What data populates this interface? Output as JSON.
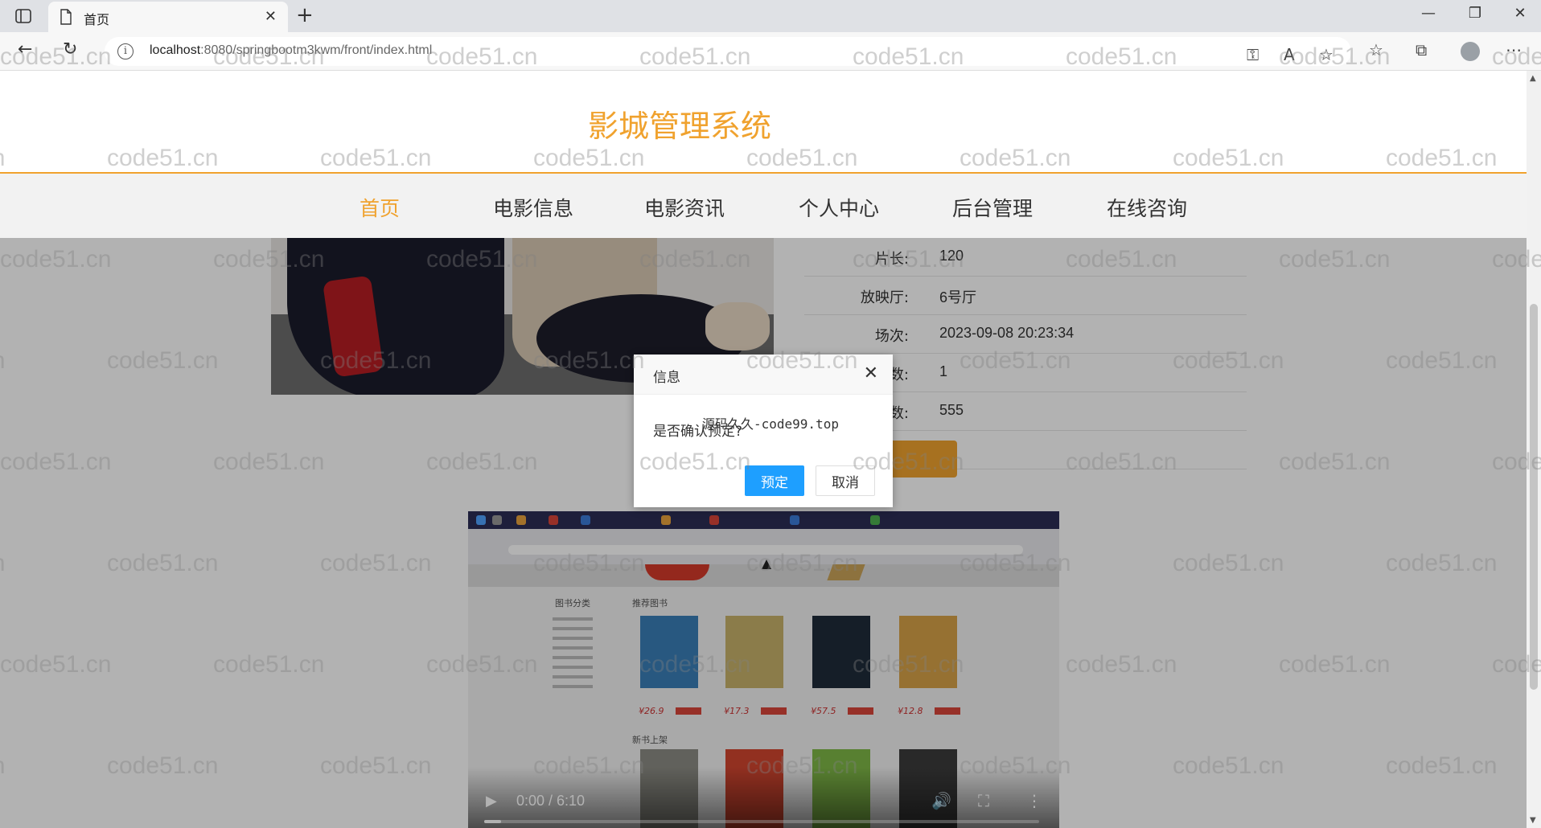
{
  "browser": {
    "tab_title": "首页",
    "url_host": "localhost",
    "url_rest": ":8080/springbootm3kwm/front/index.html"
  },
  "site": {
    "title": "影城管理系统",
    "nav": [
      {
        "label": "首页",
        "active": true
      },
      {
        "label": "电影信息",
        "active": false
      },
      {
        "label": "电影资讯",
        "active": false
      },
      {
        "label": "个人中心",
        "active": false
      },
      {
        "label": "后台管理",
        "active": false
      },
      {
        "label": "在线咨询",
        "active": false
      }
    ]
  },
  "movie": {
    "rows": [
      {
        "label": "片长:",
        "value": "120"
      },
      {
        "label": "放映厅:",
        "value": "6号厅"
      },
      {
        "label": "场次:",
        "value": "2023-09-08 20:23:34"
      },
      {
        "label": "数:",
        "value": "1"
      },
      {
        "label": "数:",
        "value": "555"
      }
    ]
  },
  "video": {
    "time": "0:00 / 6:10",
    "progress": 0.03,
    "inner_headings": [
      "图书分类",
      "推荐图书",
      "新书上架"
    ],
    "inner_prices": [
      "¥26.9",
      "¥17.3",
      "¥57.5",
      "¥12.8"
    ]
  },
  "dialog": {
    "title": "信息",
    "message": "是否确认预定?",
    "overlay_text": "源码久久-code99.top",
    "ok_label": "预定",
    "cancel_label": "取消"
  },
  "watermark": {
    "text": "code51.cn"
  },
  "colors": {
    "brand_orange": "#f0a22e",
    "primary_blue": "#1e9fff"
  }
}
